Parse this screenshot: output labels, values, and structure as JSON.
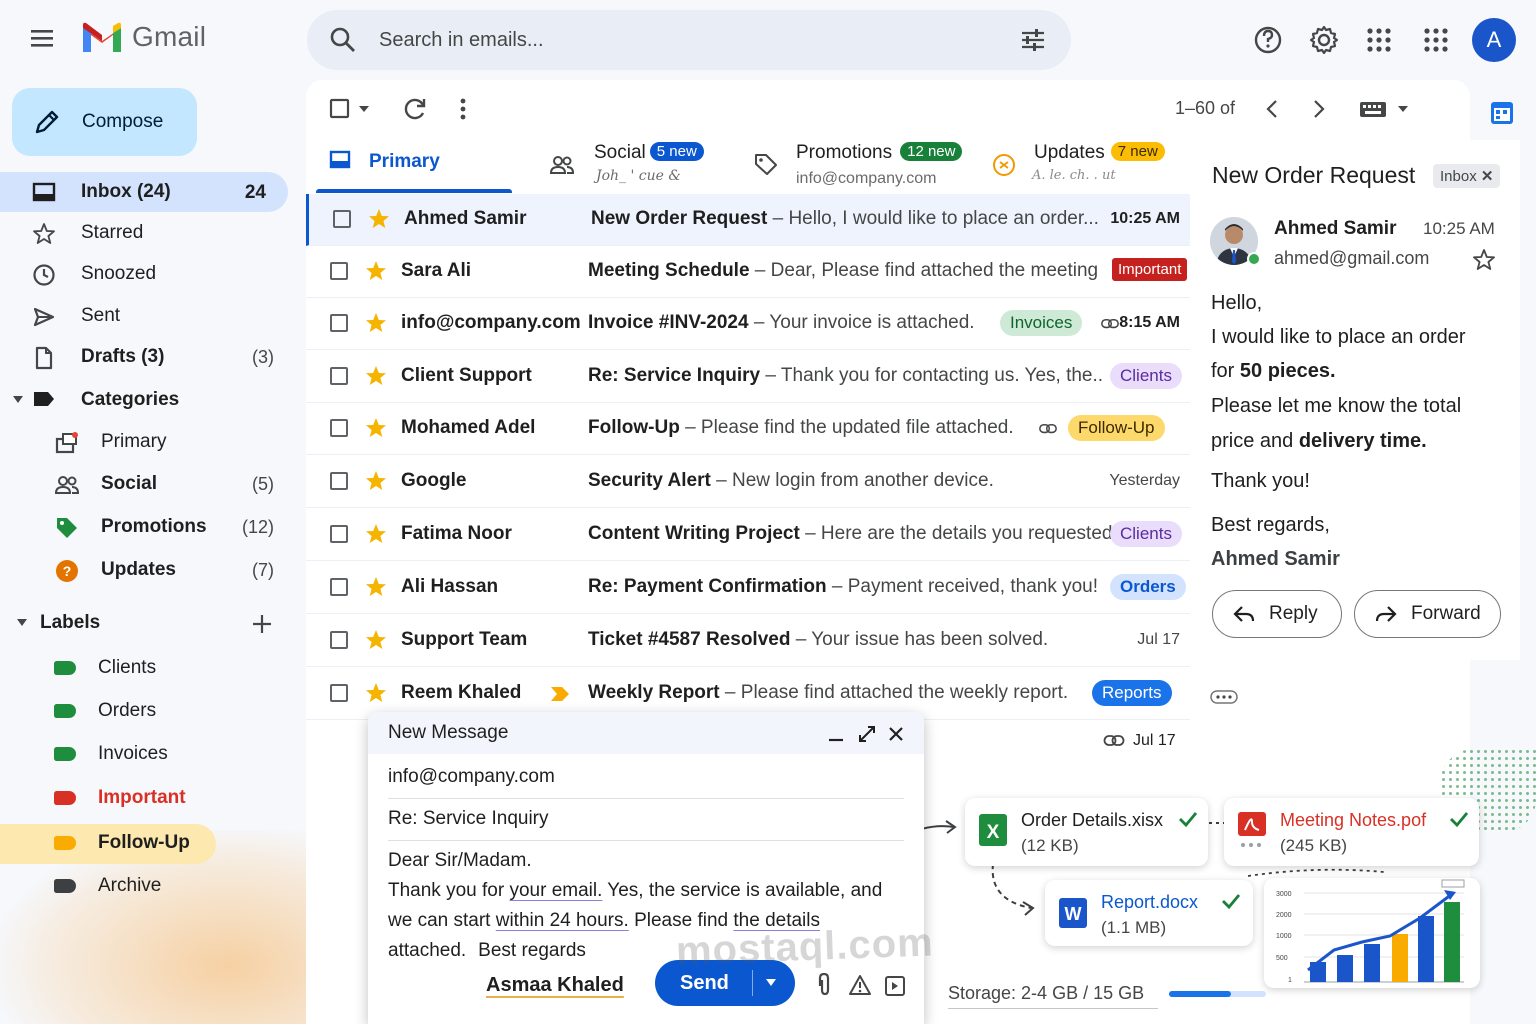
{
  "app": {
    "name": "Gmail"
  },
  "search": {
    "placeholder": "Search in emails..."
  },
  "account": {
    "initial": "A"
  },
  "compose_button": "Compose",
  "sidebar": {
    "inbox": {
      "label": "Inbox (24)",
      "count": "24"
    },
    "starred": "Starred",
    "snoozed": "Snoozed",
    "sent": "Sent",
    "drafts": {
      "label": "Drafts (3)",
      "count": "(3)"
    },
    "categories": "Categories",
    "cat_primary": "Primary",
    "cat_social": {
      "label": "Social",
      "count": "(5)"
    },
    "cat_promotions": {
      "label": "Promotions",
      "count": "(12)"
    },
    "cat_updates": {
      "label": "Updates",
      "count": "(7)"
    },
    "labels_heading": "Labels",
    "labels": [
      {
        "label": "Clients",
        "color": "#1e8e3e"
      },
      {
        "label": "Orders",
        "color": "#1e8e3e"
      },
      {
        "label": "Invoices",
        "color": "#1e8e3e"
      },
      {
        "label": "Important",
        "color": "#d93025"
      },
      {
        "label": "Follow-Up",
        "color": "#f9ab00"
      },
      {
        "label": "Archive",
        "color": "#3c4043"
      }
    ]
  },
  "toolbar": {
    "pager": "1–60 of"
  },
  "tabs": {
    "primary": "Primary",
    "social": {
      "label": "Social",
      "badge": "5 new",
      "sub": "Joh_ ' cue &"
    },
    "promotions": {
      "label": "Promotions",
      "badge": "12 new",
      "sub": "info@company.com"
    },
    "updates": {
      "label": "Updates",
      "badge": "7 new",
      "sub": "A. le. ch. . ut"
    }
  },
  "emails": [
    {
      "sender": "Ahmed Samir",
      "subject": "New Order Request",
      "snippet": " – Hello, I would like to place an order...",
      "time": "10:25 AM"
    },
    {
      "sender": "Sara Ali",
      "subject": "Meeting Schedule",
      "snippet": " – Dear, Please find attached the meeting",
      "label": "Important"
    },
    {
      "sender": "info@company.com",
      "subject": "Invoice #INV-2024",
      "snippet": " – Your invoice is attached.",
      "label": "Invoices",
      "time": "8:15 AM"
    },
    {
      "sender": "Client Support",
      "subject": "Re: Service Inquiry",
      "snippet": " – Thank you for contacting us. Yes, the..",
      "label": "Clients"
    },
    {
      "sender": "Mohamed Adel",
      "subject": "Follow-Up",
      "snippet": " – Please find the updated file attached.",
      "label": "Follow-Up"
    },
    {
      "sender": "Google",
      "subject": "Security Alert",
      "snippet": " – New login from another device.",
      "time": "Yesterday"
    },
    {
      "sender": "Fatima Noor",
      "subject": "Content Writing Project",
      "snippet": " – Here are the details you requested.",
      "label": "Clients"
    },
    {
      "sender": "Ali Hassan",
      "subject": "Re: Payment Confirmation",
      "snippet": " – Payment received, thank you!",
      "label": "Orders"
    },
    {
      "sender": "Support Team",
      "subject": "Ticket #4587 Resolved",
      "snippet": " – Your issue has been solved.",
      "time": "Jul 17"
    },
    {
      "sender": "Reem Khaled",
      "subject": "Weekly Report",
      "snippet": " – Please find attached the weekly report.",
      "label": "Reports"
    }
  ],
  "extra_row_time": "Jul 17",
  "reading": {
    "title": "New Order Request",
    "chip": "Inbox",
    "sender": "Ahmed Samir",
    "time": "10:25 AM",
    "email": "ahmed@gmail.com",
    "l1": "Hello,",
    "l2": "I would like to place an order",
    "l3a": "for ",
    "l3b": "50 pieces.",
    "l4": "Please let me know the total",
    "l5a": "price and ",
    "l5b": "delivery time.",
    "l6": "Thank you!",
    "l7": "Best regards,",
    "l8": "Ahmed Samir",
    "reply": "Reply",
    "forward": "Forward"
  },
  "compose": {
    "title": "New Message",
    "to": "info@company.com",
    "subject": "Re: Service Inquiry",
    "b1": "Dear Sir/Madam.",
    "b2a": "Thank you for ",
    "b2b": "your email.",
    "b2c": " Yes, the service is available, and",
    "b3a": "we can start ",
    "b3b": "within 24 hours.",
    "b3c": " Please find ",
    "b3d": "the details",
    "b4a": "attached.",
    "b4b": "Best regards",
    "sig": "Asmaa Khaled",
    "send": "Send"
  },
  "attachments": [
    {
      "name": "Order Details.xisx",
      "size": "(12 KB)"
    },
    {
      "name": "Meeting Notes.pof",
      "size": "(245 KB)"
    },
    {
      "name": "Report.docx",
      "size": "(1.1 MB)"
    }
  ],
  "chart_ticks": [
    "3000",
    "2000",
    "1000",
    "500"
  ],
  "storage": {
    "text": "Storage: 2-4 GB / 15 GB",
    "used_fraction": 0.16
  },
  "watermark": "mostaql.com"
}
